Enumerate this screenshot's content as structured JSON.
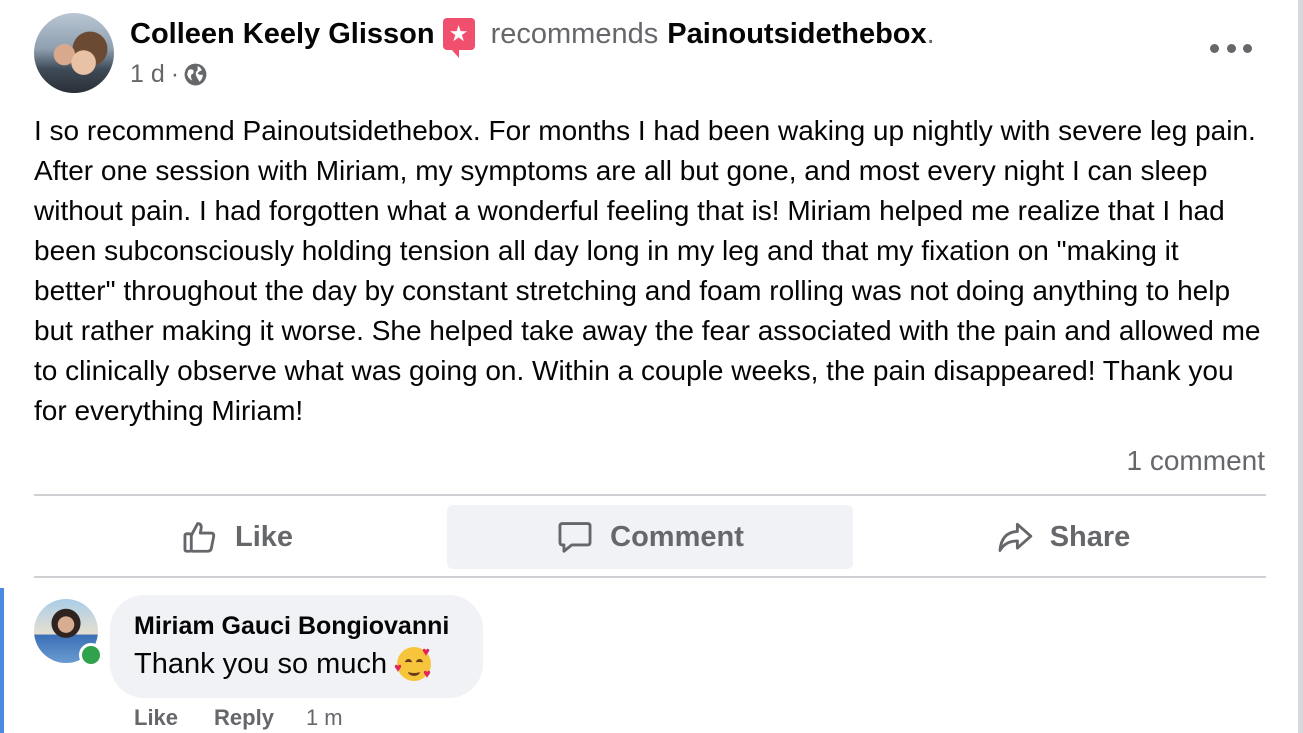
{
  "post": {
    "author": "Colleen Keely Glisson",
    "recommends_word": "recommends",
    "page_name": "Painoutsidethebox",
    "trailing_dot": ".",
    "time": "1 d",
    "meta_separator": "·",
    "badge_icon": "recommendation-star-icon",
    "privacy_icon": "globe-icon",
    "body": "I so recommend Painoutsidethebox. For months I had been waking up nightly with severe leg pain. After one session with Miriam, my symptoms are all but gone, and most every night I can sleep without pain. I had forgotten what a wonderful feeling that is! Miriam helped me realize that I had been subconsciously holding tension all day long in my leg and that my fixation on \"making it better\" throughout the day by constant stretching and foam rolling was not doing anything to help but rather making it worse. She helped take away the fear associated with the pain and allowed me to clinically observe what was going on. Within a couple weeks, the pain disappeared! Thank you for everything Miriam!",
    "comment_count": "1 comment"
  },
  "actions": {
    "like": "Like",
    "comment": "Comment",
    "share": "Share"
  },
  "comment": {
    "author": "Miriam Gauci Bongiovanni",
    "text": "Thank you so much",
    "emoji": "smiling-face-with-hearts-emoji",
    "like": "Like",
    "reply": "Reply",
    "time": "1 m",
    "online": true
  },
  "colors": {
    "text": "#050505",
    "secondary": "#65676b",
    "divider": "#ced0d4",
    "bubble": "#f0f2f5",
    "badge": "#f0506e",
    "online": "#31a24c",
    "thread_line": "#4a8be0"
  }
}
